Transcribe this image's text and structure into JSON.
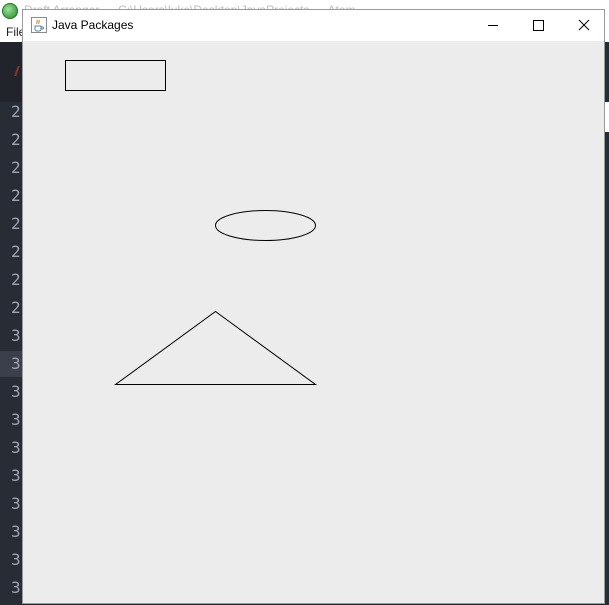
{
  "background_app": {
    "title": "Draft Arranger — C:\\Users\\luke\\Desktop\\JavaProjects — Atom",
    "menu_file": "File",
    "gutter_lines": [
      "2",
      "2",
      "2",
      "2",
      "2",
      "2",
      "2",
      "2",
      "3",
      "3",
      "3",
      "3",
      "3",
      "3",
      "3",
      "3",
      "3",
      "3"
    ]
  },
  "window": {
    "title": "Java Packages",
    "minimize_icon": "minimize-icon",
    "maximize_icon": "maximize-icon",
    "close_icon": "close-icon",
    "app_icon": "java-cup-icon"
  },
  "canvas": {
    "background": "#ececec",
    "stroke": "#000000",
    "shapes": [
      "rectangle",
      "ellipse",
      "triangle"
    ]
  }
}
